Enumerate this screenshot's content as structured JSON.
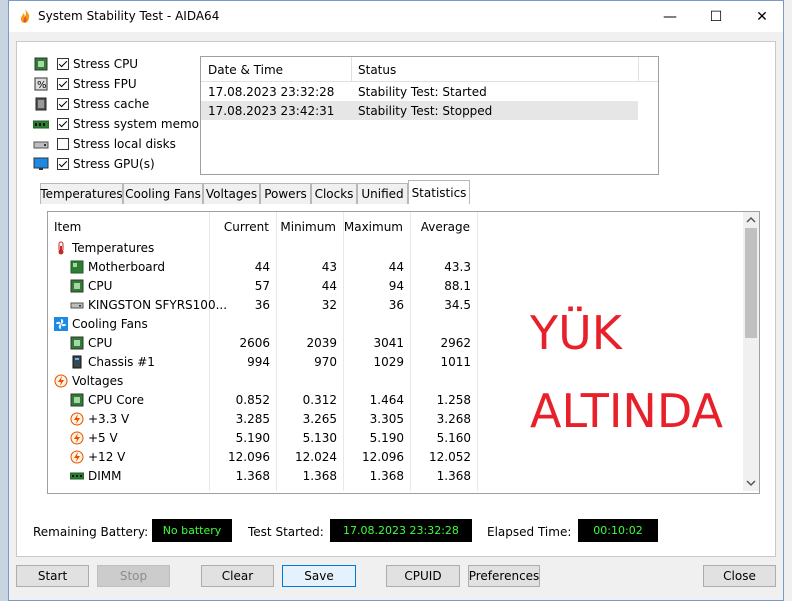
{
  "window": {
    "title": "System Stability Test - AIDA64",
    "minimize": "—",
    "maximize": "☐",
    "close": "✕"
  },
  "stress": [
    {
      "label": "Stress CPU",
      "checked": true,
      "icon": "cpu-icon"
    },
    {
      "label": "Stress FPU",
      "checked": true,
      "icon": "fpu-icon"
    },
    {
      "label": "Stress cache",
      "checked": true,
      "icon": "cache-icon"
    },
    {
      "label": "Stress system memory",
      "checked": true,
      "icon": "memory-icon"
    },
    {
      "label": "Stress local disks",
      "checked": false,
      "icon": "disk-icon"
    },
    {
      "label": "Stress GPU(s)",
      "checked": true,
      "icon": "gpu-icon"
    }
  ],
  "log": {
    "headers": {
      "datetime": "Date & Time",
      "status": "Status"
    },
    "rows": [
      {
        "datetime": "17.08.2023 23:32:28",
        "status": "Stability Test: Started"
      },
      {
        "datetime": "17.08.2023 23:42:31",
        "status": "Stability Test: Stopped"
      }
    ]
  },
  "tabs": [
    "Temperatures",
    "Cooling Fans",
    "Voltages",
    "Powers",
    "Clocks",
    "Unified",
    "Statistics"
  ],
  "active_tab": "Statistics",
  "stats": {
    "headers": {
      "item": "Item",
      "current": "Current",
      "minimum": "Minimum",
      "maximum": "Maximum",
      "average": "Average"
    },
    "groups": {
      "temperatures": "Temperatures",
      "fans": "Cooling Fans",
      "voltages": "Voltages"
    },
    "rows": [
      {
        "item": "Motherboard",
        "current": "44",
        "minimum": "43",
        "maximum": "44",
        "average": "43.3"
      },
      {
        "item": "CPU",
        "current": "57",
        "minimum": "44",
        "maximum": "94",
        "average": "88.1"
      },
      {
        "item": "KINGSTON SFYRS100...",
        "current": "36",
        "minimum": "32",
        "maximum": "36",
        "average": "34.5"
      },
      {
        "item": "CPU",
        "current": "2606",
        "minimum": "2039",
        "maximum": "3041",
        "average": "2962"
      },
      {
        "item": "Chassis #1",
        "current": "994",
        "minimum": "970",
        "maximum": "1029",
        "average": "1011"
      },
      {
        "item": "CPU Core",
        "current": "0.852",
        "minimum": "0.312",
        "maximum": "1.464",
        "average": "1.258"
      },
      {
        "item": "+3.3 V",
        "current": "3.285",
        "minimum": "3.265",
        "maximum": "3.305",
        "average": "3.268"
      },
      {
        "item": "+5 V",
        "current": "5.190",
        "minimum": "5.130",
        "maximum": "5.190",
        "average": "5.160"
      },
      {
        "item": "+12 V",
        "current": "12.096",
        "minimum": "12.024",
        "maximum": "12.096",
        "average": "12.052"
      },
      {
        "item": "DIMM",
        "current": "1.368",
        "minimum": "1.368",
        "maximum": "1.368",
        "average": "1.368"
      }
    ]
  },
  "overlay": {
    "line1": "YÜK",
    "line2": "ALTINDA",
    "color": "#e8202a"
  },
  "status": {
    "battery_label": "Remaining Battery:",
    "battery_value": "No battery",
    "started_label": "Test Started:",
    "started_value": "17.08.2023 23:32:28",
    "elapsed_label": "Elapsed Time:",
    "elapsed_value": "00:10:02"
  },
  "buttons": {
    "start": "Start",
    "stop": "Stop",
    "clear": "Clear",
    "save": "Save",
    "cpuid": "CPUID",
    "preferences": "Preferences",
    "close": "Close"
  }
}
